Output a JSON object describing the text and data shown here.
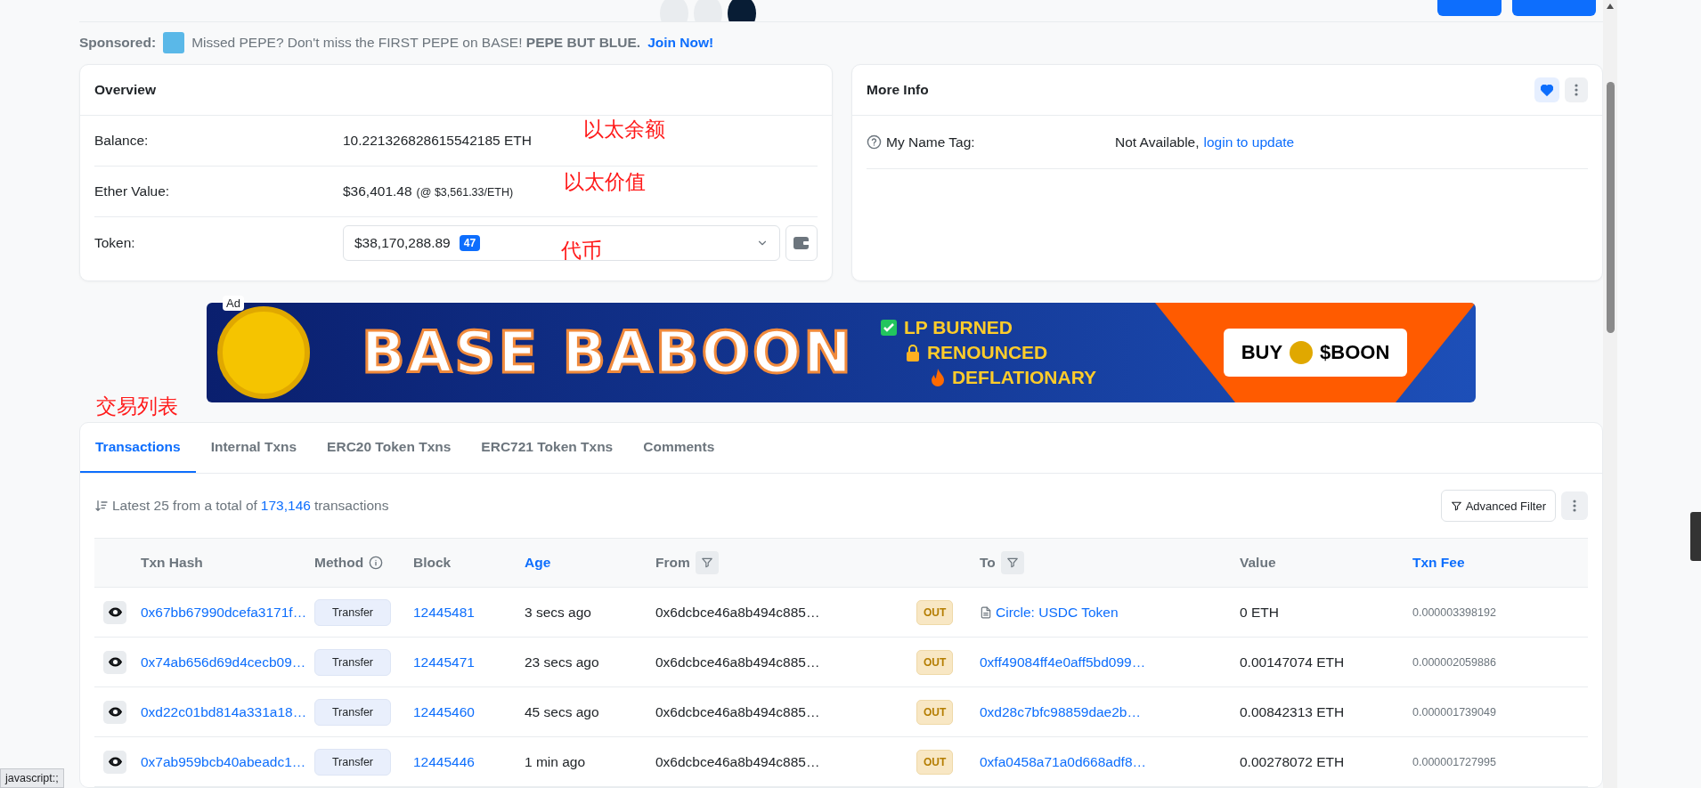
{
  "sponsored": {
    "label": "Sponsored:",
    "text": "Missed PEPE? Don't miss the FIRST PEPE on BASE! **PEPE BUT BLUE.**",
    "link": "Join Now!"
  },
  "overview": {
    "title": "Overview",
    "rows": [
      {
        "kind": "plain",
        "label": "Balance:",
        "value": "10.221326828615542185 ETH",
        "annotation": "以太余额"
      },
      {
        "kind": "price",
        "label": "Ether Value:",
        "value": "$36,401.48",
        "note": "(@ $3,561.33/ETH)",
        "annotation": "以太价值"
      },
      {
        "kind": "token",
        "label": "Token:",
        "value": "$38,170,288.89",
        "badge": "47",
        "annotation": "代币"
      }
    ]
  },
  "more_info": {
    "title": "More Info",
    "favorite": true,
    "rows": [
      {
        "label": "My Name Tag:",
        "value": "Not Available,",
        "link": "login to update"
      }
    ]
  },
  "banner": {
    "ad_label": "Ad",
    "title": "BASE BABOON",
    "features": [
      {
        "kind": "check",
        "text": "LP BURNED"
      },
      {
        "kind": "lock",
        "text": "RENOUNCED"
      },
      {
        "kind": "fire",
        "text": "DEFLATIONARY"
      }
    ],
    "cta_left": "BUY",
    "cta_right": "$BOON"
  },
  "section_annotation": "交易列表",
  "tabs": [
    {
      "label": "Transactions",
      "selected": true
    },
    {
      "label": "Internal Txns",
      "selected": false
    },
    {
      "label": "ERC20 Token Txns",
      "selected": false
    },
    {
      "label": "ERC721 Token Txns",
      "selected": false
    },
    {
      "label": "Comments",
      "selected": false
    }
  ],
  "summary": {
    "prefix": "Latest 25 from a total of",
    "count": "173,146",
    "suffix": "transactions"
  },
  "filter_button": "Advanced Filter",
  "columns": [
    {
      "label": "Txn Hash",
      "kind": "plain"
    },
    {
      "label": "Method",
      "kind": "info"
    },
    {
      "label": "Block",
      "kind": "plain"
    },
    {
      "label": "Age",
      "kind": "link"
    },
    {
      "label": "From",
      "kind": "filter"
    },
    {
      "label": "To",
      "kind": "filter"
    },
    {
      "label": "Value",
      "kind": "plain"
    },
    {
      "label": "Txn Fee",
      "kind": "link"
    }
  ],
  "rows": [
    {
      "hash": "0x67bb67990dcefa3171f…",
      "method": "Transfer",
      "block": "12445481",
      "age": "3 secs ago",
      "from": "0x6dcbce46a8b494c885…",
      "direction": "OUT",
      "to": "Circle: USDC Token",
      "contract_icon": true,
      "value": "0 ETH",
      "fee": "0.000003398192"
    },
    {
      "hash": "0x74ab656d69d4cecb09…",
      "method": "Transfer",
      "block": "12445471",
      "age": "23 secs ago",
      "from": "0x6dcbce46a8b494c885…",
      "direction": "OUT",
      "to": "0xff49084ff4e0aff5bd099…",
      "contract_icon": false,
      "value": "0.00147074 ETH",
      "fee": "0.000002059886"
    },
    {
      "hash": "0xd22c01bd814a331a18…",
      "method": "Transfer",
      "block": "12445460",
      "age": "45 secs ago",
      "from": "0x6dcbce46a8b494c885…",
      "direction": "OUT",
      "to": "0xd28c7bfc98859dae2b…",
      "contract_icon": false,
      "value": "0.00842313 ETH",
      "fee": "0.000001739049"
    },
    {
      "hash": "0x7ab959bcb40abeadc1…",
      "method": "Transfer",
      "block": "12445446",
      "age": "1 min ago",
      "from": "0x6dcbce46a8b494c885…",
      "direction": "OUT",
      "to": "0xfa0458a71a0d668adf8…",
      "contract_icon": false,
      "value": "0.00278072 ETH",
      "fee": "0.000001727995"
    }
  ],
  "status_tooltip": "javascript:;"
}
